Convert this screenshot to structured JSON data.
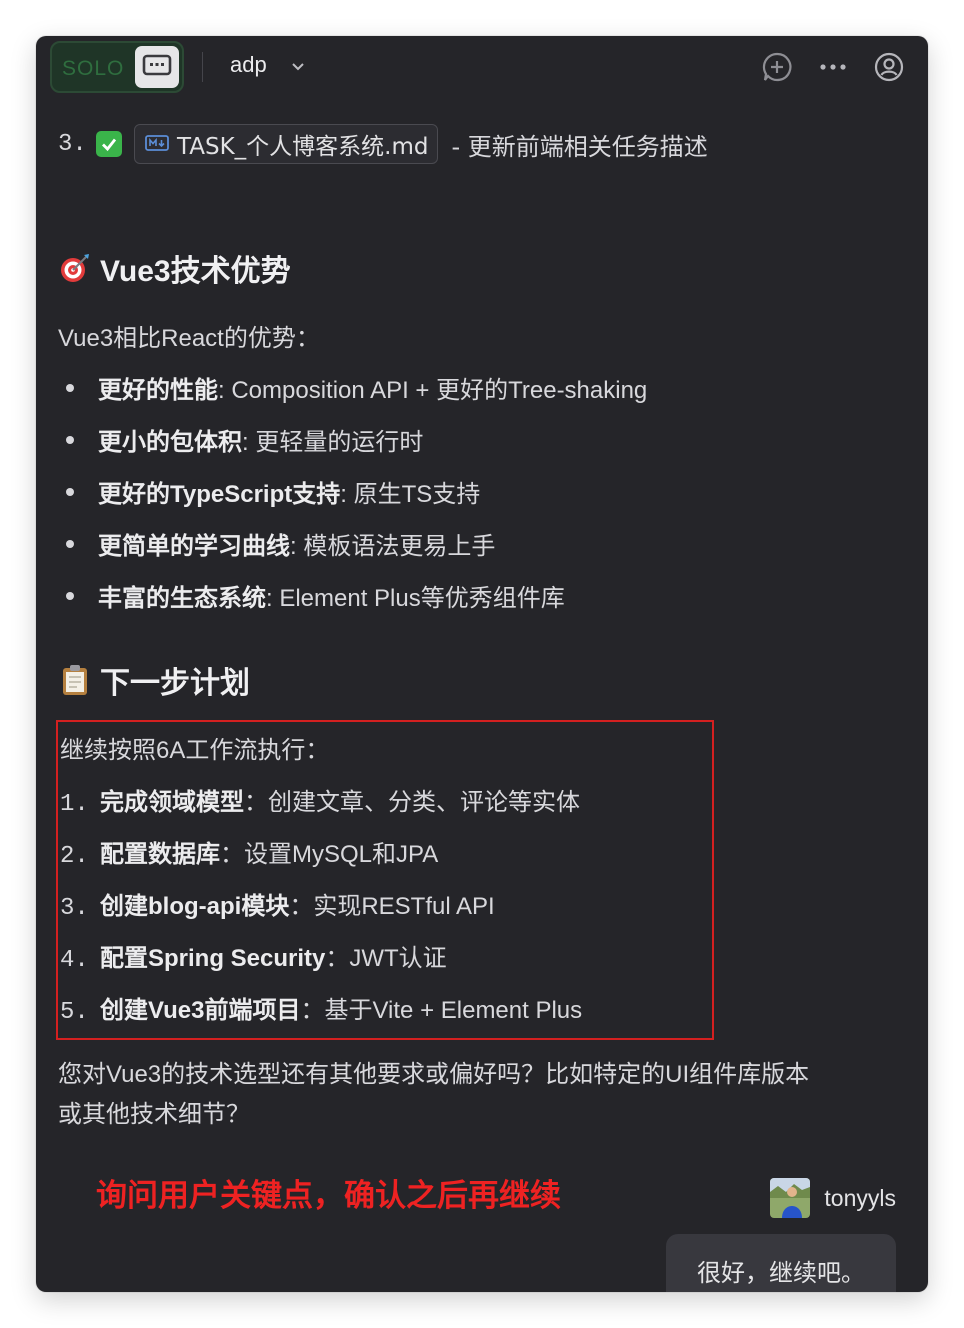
{
  "header": {
    "solo_label": "SOLO",
    "project_name": "adp",
    "icons": [
      "new-chat-icon",
      "more-icon",
      "account-icon"
    ]
  },
  "task_item": {
    "number": "3.",
    "file_name": "TASK_个人博客系统.md",
    "description": "- 更新前端相关任务描述"
  },
  "section_vue": {
    "title": "Vue3技术优势",
    "intro": "Vue3相比React的优势：",
    "bullets": [
      {
        "bold": "更好的性能",
        "text": ": Composition API + 更好的Tree-shaking"
      },
      {
        "bold": "更小的包体积",
        "text": ": 更轻量的运行时"
      },
      {
        "bold": "更好的TypeScript支持",
        "text": ": 原生TS支持"
      },
      {
        "bold": "更简单的学习曲线",
        "text": ": 模板语法更易上手"
      },
      {
        "bold": "丰富的生态系统",
        "text": ": Element Plus等优秀组件库"
      }
    ]
  },
  "section_plan": {
    "title": "下一步计划",
    "intro": "继续按照6A工作流执行：",
    "steps": [
      {
        "num": "1.",
        "bold": "完成领域模型",
        "text": "：创建文章、分类、评论等实体"
      },
      {
        "num": "2.",
        "bold": "配置数据库",
        "text": "：设置MySQL和JPA"
      },
      {
        "num": "3.",
        "bold": "创建blog-api模块",
        "text": "：实现RESTful API"
      },
      {
        "num": "4.",
        "bold": "配置Spring Security",
        "text": "：JWT认证"
      },
      {
        "num": "5.",
        "bold": "创建Vue3前端项目",
        "text": "：基于Vite + Element Plus"
      }
    ]
  },
  "question": {
    "line1": "您对Vue3的技术选型还有其他要求或偏好吗？比如特定的UI组件库版本",
    "line2": "或其他技术细节？"
  },
  "annotation": "询问用户关键点，确认之后再继续",
  "user": {
    "name": "tonyyls",
    "message": "很好，继续吧。"
  },
  "colors": {
    "background": "#252529",
    "annotation_red": "#ee2222",
    "highlight_border": "#d42020",
    "check_green": "#3ab44a",
    "solo_green": "#2f6e3f"
  }
}
